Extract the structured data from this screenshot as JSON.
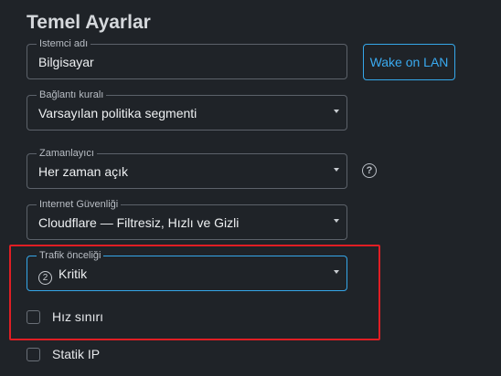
{
  "section_title": "Temel Ayarlar",
  "client_name": {
    "label": "Istemci adı",
    "value": "Bilgisayar"
  },
  "wake_on_lan_label": "Wake on LAN",
  "connection_rule": {
    "label": "Bağlantı kuralı",
    "value": "Varsayılan politika segmenti"
  },
  "scheduler": {
    "label": "Zamanlayıcı",
    "value": "Her zaman açık"
  },
  "help_icon_glyph": "?",
  "internet_security": {
    "label": "Internet Güvenliği",
    "value": "Cloudflare — Filtresiz, Hızlı ve Gizli"
  },
  "traffic_priority": {
    "label": "Trafik önceliği",
    "level": "2",
    "value": "Kritik"
  },
  "speed_limit": {
    "label": "Hız sınırı",
    "checked": false
  },
  "static_ip": {
    "label": "Statik IP",
    "checked": false
  },
  "colors": {
    "accent": "#35a7ea",
    "highlight": "#e01e24",
    "background": "#1f2328"
  }
}
